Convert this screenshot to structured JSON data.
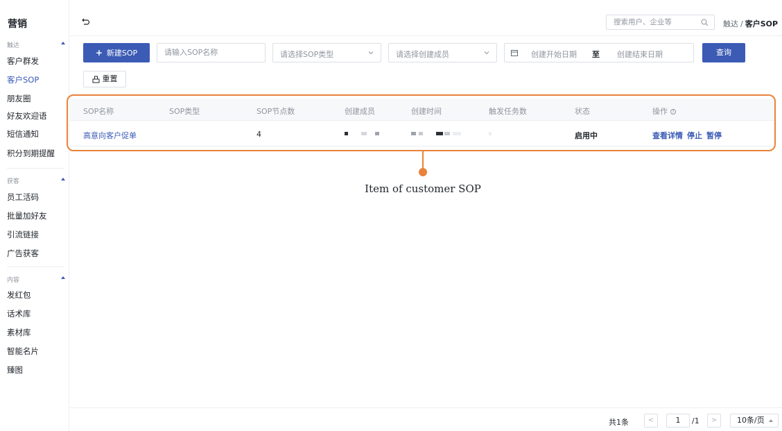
{
  "sidebar": {
    "brand": "营销",
    "groups": [
      {
        "title": "触达",
        "items": [
          "客户群发",
          "客户SOP",
          "朋友圈",
          "好友欢迎语",
          "短信通知",
          "积分到期提醒"
        ]
      },
      {
        "title": "获客",
        "items": [
          "员工活码",
          "批量加好友",
          "引流链接",
          "广告获客"
        ]
      },
      {
        "title": "内容",
        "items": [
          "发红包",
          "话术库",
          "素材库",
          "智能名片",
          "臻图"
        ]
      }
    ],
    "active_item": "客户SOP"
  },
  "header": {
    "search_placeholder": "搜索用户、企业等",
    "breadcrumb_parent": "触达",
    "breadcrumb_sep": "/",
    "breadcrumb_current": "客户SOP"
  },
  "filters": {
    "new_button": "新建SOP",
    "name_placeholder": "请输入SOP名称",
    "type_placeholder": "请选择SOP类型",
    "member_placeholder": "请选择创建成员",
    "date_start": "创建开始日期",
    "date_sep": "至",
    "date_end": "创建结束日期",
    "query_button": "查询",
    "reset_button": "重置"
  },
  "table": {
    "columns": [
      "SOP名称",
      "SOP类型",
      "SOP节点数",
      "创建成员",
      "创建时间",
      "触发任务数",
      "状态",
      "操作"
    ],
    "rows": [
      {
        "name": "高意向客户促单",
        "type": "",
        "nodes": "4",
        "status": "启用中",
        "actions": [
          "查看详情",
          "停止",
          "暂停"
        ]
      }
    ]
  },
  "annotation": {
    "label": "Item of customer SOP"
  },
  "pagination": {
    "total": "共1条",
    "current_page": "1",
    "total_pages": "/1",
    "page_size": "10条/页"
  },
  "colors": {
    "accent": "#3b5bb5",
    "highlight": "#e8833a"
  }
}
